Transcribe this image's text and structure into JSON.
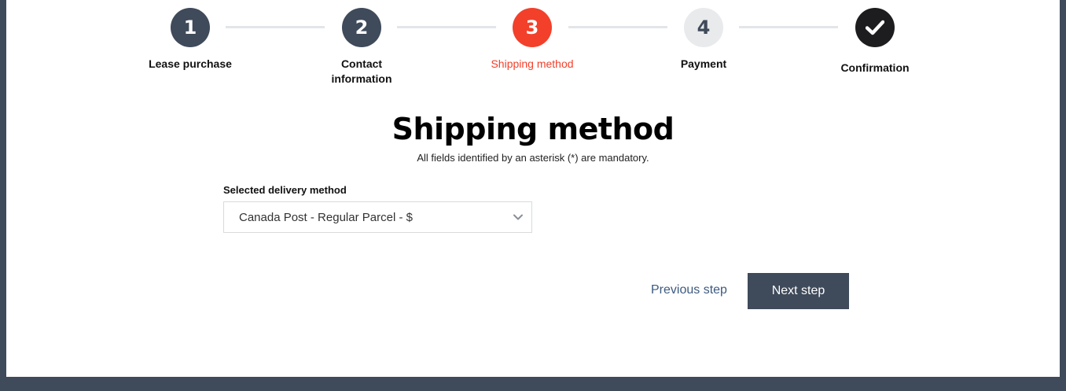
{
  "stepper": {
    "steps": [
      {
        "number": "1",
        "label": "Lease purchase",
        "state": "completed"
      },
      {
        "number": "2",
        "label": "Contact information",
        "state": "completed"
      },
      {
        "number": "3",
        "label": "Shipping method",
        "state": "active"
      },
      {
        "number": "4",
        "label": "Payment",
        "state": "pending"
      },
      {
        "number": "",
        "label": "Confirmation",
        "state": "final",
        "icon": "checkmark-icon"
      }
    ]
  },
  "page": {
    "title": "Shipping method",
    "subtitle": "All fields identified by an asterisk (*) are mandatory."
  },
  "delivery": {
    "label": "Selected delivery method",
    "value": "Canada Post - Regular Parcel - $"
  },
  "actions": {
    "previous_label": "Previous step",
    "next_label": "Next step"
  },
  "colors": {
    "navy": "#3f4a5a",
    "accent": "#f2402b",
    "pending": "#e9eaec",
    "link": "#3d5a80"
  }
}
